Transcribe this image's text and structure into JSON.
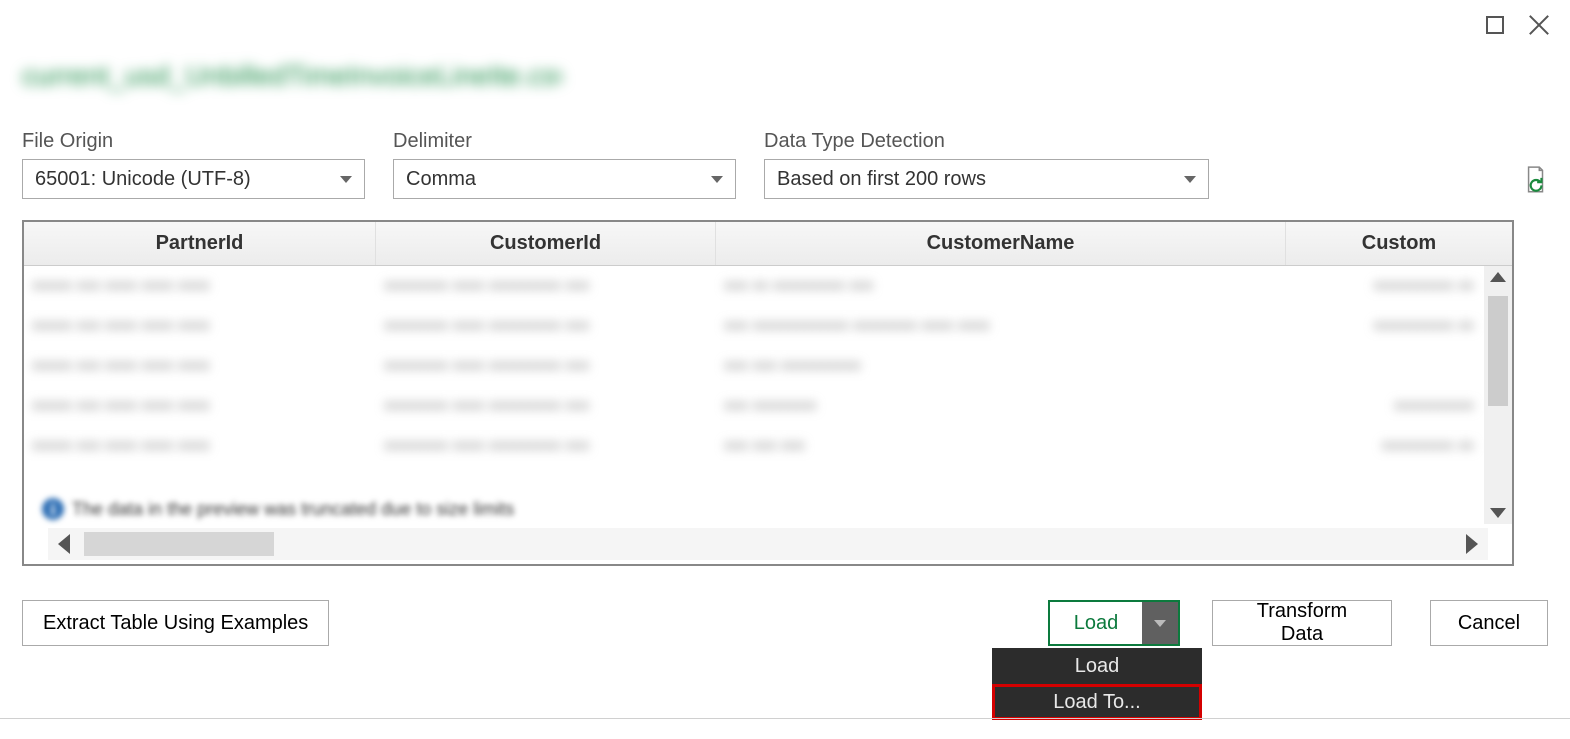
{
  "window": {
    "title_blurred": "current_usd_UnbilledTimeInvoiceLineIte.csv"
  },
  "config": {
    "file_origin": {
      "label": "File Origin",
      "value": "65001: Unicode (UTF-8)"
    },
    "delimiter": {
      "label": "Delimiter",
      "value": "Comma"
    },
    "data_type": {
      "label": "Data Type Detection",
      "value": "Based on first 200 rows"
    }
  },
  "table": {
    "columns": [
      "PartnerId",
      "CustomerId",
      "CustomerName",
      "Custom"
    ],
    "truncation_note": "The data in the preview was truncated due to size limits"
  },
  "footer": {
    "extract": "Extract Table Using Examples",
    "load": "Load",
    "transform": "Transform Data",
    "cancel": "Cancel",
    "dropdown": {
      "load": "Load",
      "load_to": "Load To..."
    }
  }
}
